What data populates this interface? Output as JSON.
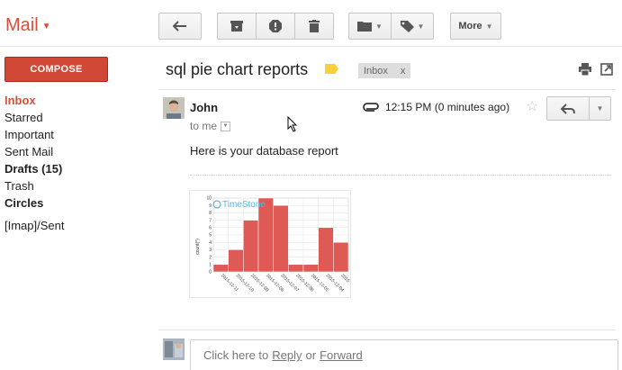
{
  "app": {
    "title": "Mail"
  },
  "toolbar": {
    "more_label": "More"
  },
  "sidebar": {
    "compose_label": "COMPOSE",
    "items": [
      {
        "label": "Inbox"
      },
      {
        "label": "Starred"
      },
      {
        "label": "Important"
      },
      {
        "label": "Sent Mail"
      },
      {
        "label": "Drafts (15)"
      },
      {
        "label": "Trash"
      },
      {
        "label": "Circles"
      },
      {
        "label": "[Imap]/Sent"
      }
    ]
  },
  "message": {
    "subject": "sql pie chart reports",
    "label_chip": "Inbox",
    "label_chip_close": "x",
    "sender": "John",
    "recipient": "to me",
    "time": "12:15 PM (0 minutes ago)",
    "body": "Here is your database report"
  },
  "reply": {
    "prefix": "Click here to",
    "reply_link": "Reply",
    "or": "or",
    "forward_link": "Forward"
  },
  "colors": {
    "brand": "#dd4b39",
    "compose": "#d14836",
    "label_yellow": "#f5d13a",
    "bar": "#e05a55"
  },
  "chart_data": {
    "type": "bar",
    "watermark": "TimeStone",
    "ylabel": "count(*)",
    "ylim": [
      0,
      10
    ],
    "yticks": [
      "0",
      "1",
      "2",
      "3",
      "4",
      "5",
      "6",
      "7",
      "8",
      "9",
      "10"
    ],
    "categories": [
      "2015-12-11",
      "2015-12-10",
      "2015-12-09",
      "2015-12-08",
      "2015-12-07",
      "2015-12-06",
      "2015-12-05",
      "2015-12-04",
      "2015"
    ],
    "values": [
      1,
      3,
      7,
      10,
      9,
      1,
      1,
      6,
      4
    ]
  }
}
